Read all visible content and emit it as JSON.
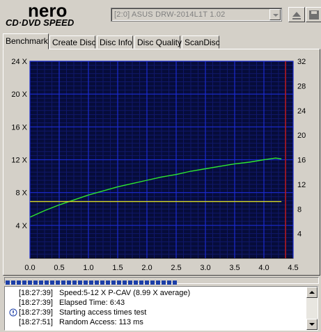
{
  "app": {
    "logo_top": "nero",
    "logo_bottom": "CD·DVD SPEED"
  },
  "drive": {
    "selected": "[2:0]  ASUS DRW-2014L1T 1.02"
  },
  "tabs": [
    "Benchmark",
    "Create Disc",
    "Disc Info",
    "Disc Quality",
    "ScanDisc"
  ],
  "active_tab": 0,
  "colors": {
    "plot_bg": "#060c3a",
    "grid": "#1b2bd0",
    "speed": "#2ee82e",
    "rpm": "#d8d820",
    "marker": "#c01818",
    "progress": "#1c3fa8"
  },
  "chart_data": {
    "type": "line",
    "xlim": [
      0,
      4.5
    ],
    "ylim_left": [
      0,
      24
    ],
    "ylim_right": [
      0,
      32
    ],
    "x_ticks": [
      "0.0",
      "0.5",
      "1.0",
      "1.5",
      "2.0",
      "2.5",
      "3.0",
      "3.5",
      "4.0",
      "4.5"
    ],
    "y_left_ticks": [
      "4 X",
      "8 X",
      "12 X",
      "16 X",
      "20 X",
      "24 X"
    ],
    "y_right_ticks": [
      "4",
      "8",
      "12",
      "16",
      "20",
      "24",
      "28",
      "32"
    ],
    "end_marker_x": 4.37,
    "series": [
      {
        "color": "speed",
        "x": [
          0,
          0.25,
          0.5,
          0.75,
          1.0,
          1.25,
          1.5,
          1.75,
          2.0,
          2.25,
          2.5,
          2.75,
          3.0,
          3.25,
          3.5,
          3.75,
          4.0,
          4.2,
          4.3
        ],
        "y": [
          5.0,
          5.8,
          6.5,
          7.1,
          7.7,
          8.2,
          8.7,
          9.1,
          9.5,
          9.9,
          10.2,
          10.6,
          10.9,
          11.2,
          11.5,
          11.7,
          12.0,
          12.2,
          12.1
        ]
      },
      {
        "color": "rpm",
        "x": [
          0,
          0.5,
          1.0,
          1.5,
          2.0,
          2.5,
          3.0,
          3.5,
          4.0,
          4.3
        ],
        "y": [
          6.9,
          6.9,
          6.9,
          6.9,
          6.9,
          6.9,
          6.9,
          6.9,
          6.9,
          6.9
        ]
      }
    ]
  },
  "progress_fraction": 0.55,
  "log": [
    {
      "time": "[18:27:39]",
      "msg": "Speed:5-12 X P-CAV (8.99 X average)",
      "icon": ""
    },
    {
      "time": "[18:27:39]",
      "msg": "Elapsed Time:  6:43",
      "icon": ""
    },
    {
      "time": "[18:27:39]",
      "msg": "Starting access times test",
      "icon": "info-icon"
    },
    {
      "time": "[18:27:51]",
      "msg": "Random Access:  113 ms",
      "icon": ""
    }
  ]
}
